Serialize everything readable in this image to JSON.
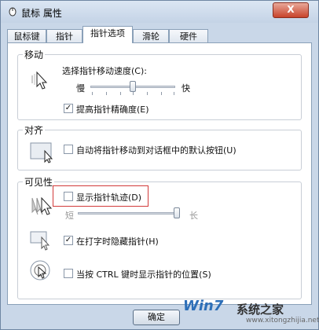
{
  "window": {
    "title": "鼠标 属性",
    "close": "X"
  },
  "tabs": [
    "鼠标键",
    "指针",
    "指针选项",
    "滑轮",
    "硬件"
  ],
  "motion": {
    "group": "移动",
    "speed_label": "选择指针移动速度(C):",
    "slow": "慢",
    "fast": "快",
    "speed_value": 0.5,
    "precision_label": "提高指针精确度(E)",
    "precision_checked": true
  },
  "snap": {
    "group": "对齐",
    "label": "自动将指针移动到对话框中的默认按钮(U)",
    "checked": false
  },
  "visibility": {
    "group": "可见性",
    "trails_label": "显示指针轨迹(D)",
    "trails_checked": false,
    "short": "短",
    "long": "长",
    "trails_value": 1.0,
    "hide_label": "在打字时隐藏指针(H)",
    "hide_checked": true,
    "ctrl_label": "当按 CTRL 键时显示指针的位置(S)",
    "ctrl_checked": false
  },
  "buttons": {
    "ok": "确定"
  },
  "watermark": {
    "win7": "Win7",
    "brand": "系统之家",
    "url": "www.xitongzhijia.net"
  },
  "icons": [
    "mouse-icon",
    "motion-pointer-icon",
    "snap-pointer-icon",
    "trails-pointer-icon",
    "hide-pointer-icon",
    "locate-pointer-icon"
  ]
}
